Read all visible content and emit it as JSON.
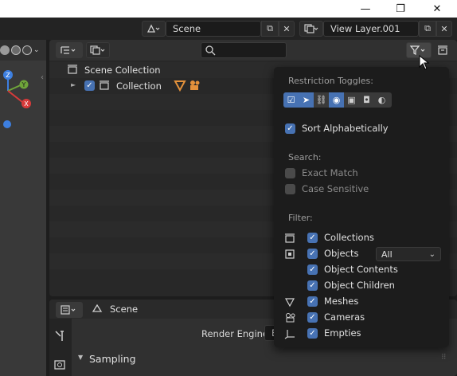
{
  "window": {
    "minimize_glyph": "—",
    "maximize_glyph": "❐",
    "close_glyph": "✕"
  },
  "topbar": {
    "scene_field": "Scene",
    "view_layer_field": "View Layer.001"
  },
  "outliner": {
    "root_label": "Scene Collection",
    "collection_label": "Collection",
    "search_placeholder": ""
  },
  "filter_popover": {
    "restriction_heading": "Restriction Toggles:",
    "sort_alpha_label": "Sort Alphabetically",
    "sort_alpha_checked": true,
    "search_heading": "Search:",
    "exact_match_label": "Exact Match",
    "exact_match_checked": false,
    "case_sensitive_label": "Case Sensitive",
    "case_sensitive_checked": false,
    "filter_heading": "Filter:",
    "items": [
      {
        "label": "Collections",
        "checked": true,
        "icon": "collection-icon"
      },
      {
        "label": "Objects",
        "checked": true,
        "icon": "object-icon"
      },
      {
        "label": "Object Contents",
        "checked": true,
        "icon": ""
      },
      {
        "label": "Object Children",
        "checked": true,
        "icon": ""
      },
      {
        "label": "Meshes",
        "checked": true,
        "icon": "mesh-icon"
      },
      {
        "label": "Cameras",
        "checked": true,
        "icon": "camera-icon"
      },
      {
        "label": "Empties",
        "checked": true,
        "icon": "empty-icon"
      }
    ],
    "objects_dropdown_value": "All"
  },
  "properties": {
    "scene_label": "Scene",
    "render_engine_label": "Render Engine",
    "render_engine_value": "E",
    "sampling_label": "Sampling"
  },
  "colors": {
    "accent": "#4772b3",
    "popover_bg": "#1c1c1c",
    "orange_icon": "#e3913b"
  }
}
